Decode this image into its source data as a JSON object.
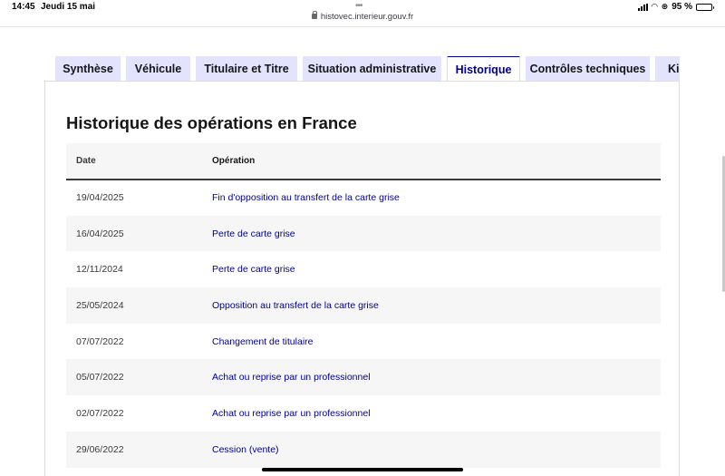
{
  "status_bar": {
    "time": "14:45",
    "date": "Jeudi 15 mai",
    "battery": "95 %",
    "battery_level": 0.95
  },
  "browser": {
    "url": "histovec.interieur.gouv.fr"
  },
  "tabs": [
    {
      "label": "Synthèse",
      "active": false
    },
    {
      "label": "Véhicule",
      "active": false
    },
    {
      "label": "Titulaire et Titre",
      "active": false
    },
    {
      "label": "Situation administrative",
      "active": false
    },
    {
      "label": "Historique",
      "active": true
    },
    {
      "label": "Contrôles techniques",
      "active": false
    },
    {
      "label": "Kil",
      "active": false
    }
  ],
  "section": {
    "title": "Historique des opérations en France"
  },
  "table": {
    "headers": [
      "Date",
      "Opération"
    ],
    "rows": [
      {
        "date": "19/04/2025",
        "operation": "Fin d'opposition au transfert de la carte grise"
      },
      {
        "date": "16/04/2025",
        "operation": "Perte de carte grise"
      },
      {
        "date": "12/11/2024",
        "operation": "Perte de carte grise"
      },
      {
        "date": "25/05/2024",
        "operation": "Opposition au transfert de la carte grise"
      },
      {
        "date": "07/07/2022",
        "operation": "Changement de titulaire"
      },
      {
        "date": "05/07/2022",
        "operation": "Achat ou reprise par un professionnel"
      },
      {
        "date": "02/07/2022",
        "operation": "Achat ou reprise par un professionnel"
      },
      {
        "date": "29/06/2022",
        "operation": "Cession (vente)"
      }
    ]
  },
  "colors": {
    "accent": "#000091",
    "tab_background": "#e3e3fd",
    "row_alt": "#f6f6f6"
  }
}
